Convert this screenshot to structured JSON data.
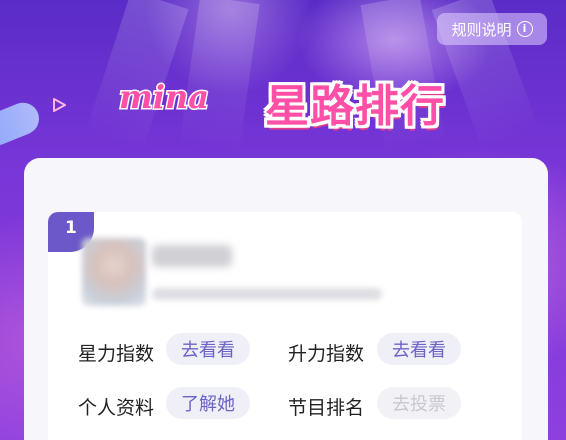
{
  "header": {
    "logo_text": "mina",
    "title": "星路排行",
    "rules_label": "规则说明",
    "info_glyph": "i"
  },
  "entry": {
    "rank": "1",
    "name_redacted": true,
    "stats": [
      {
        "label": "星力指数",
        "action": "去看看",
        "state": "active"
      },
      {
        "label": "升力指数",
        "action": "去看看",
        "state": "active"
      },
      {
        "label": "个人资料",
        "action": "了解她",
        "state": "active"
      },
      {
        "label": "节目排名",
        "action": "去投票",
        "state": "disabled"
      }
    ]
  },
  "colors": {
    "brand_pink": "#ff4fa6",
    "accent_purple": "#6c58c9",
    "pill_text": "#6b63c6",
    "disabled_text": "#c7c7d0"
  },
  "icons": [
    "info-icon",
    "triangle-decoration-icon",
    "mina-logo"
  ]
}
